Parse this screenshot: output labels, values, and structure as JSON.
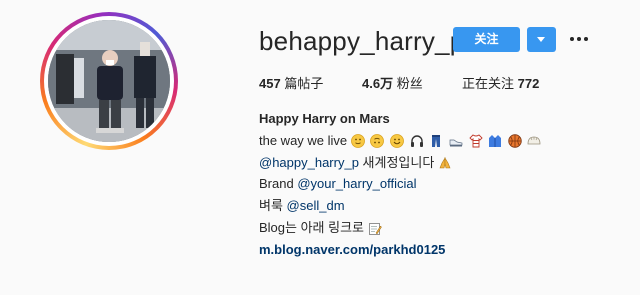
{
  "profile": {
    "username": "behappy_harry_p",
    "follow_label": "关注",
    "stats": {
      "posts_count": "457",
      "posts_label": "篇帖子",
      "followers_count": "4.6万",
      "followers_label": "粉丝",
      "following_label": "正在关注",
      "following_count": "772"
    },
    "bio": {
      "name": "Happy Harry on Mars",
      "line1_text": "the way we live",
      "line1_emojis": [
        "slight-smile-emoji",
        "upside-down-face-emoji",
        "smile-emoji",
        "headphones-emoji",
        "jeans-emoji",
        "sneaker-emoji",
        "tshirt-emoji",
        "coat-emoji",
        "basketball-emoji",
        "dumpling-emoji"
      ],
      "line2_mention": "@happy_harry_p",
      "line2_text": " 새계정입니다",
      "line2_emoji": "folded-hands-emoji",
      "line3_prefix": "Brand ",
      "line3_mention": "@your_harry_official",
      "line4_prefix": "벼룩 ",
      "line4_mention": "@sell_dm",
      "line5_text": "Blog는 아래 링크로",
      "line5_emoji": "memo-emoji",
      "link": "m.blog.naver.com/parkhd0125"
    }
  },
  "colors": {
    "accent": "#3897f0",
    "mention": "#003569",
    "text": "#262626",
    "background": "#fafafa"
  }
}
